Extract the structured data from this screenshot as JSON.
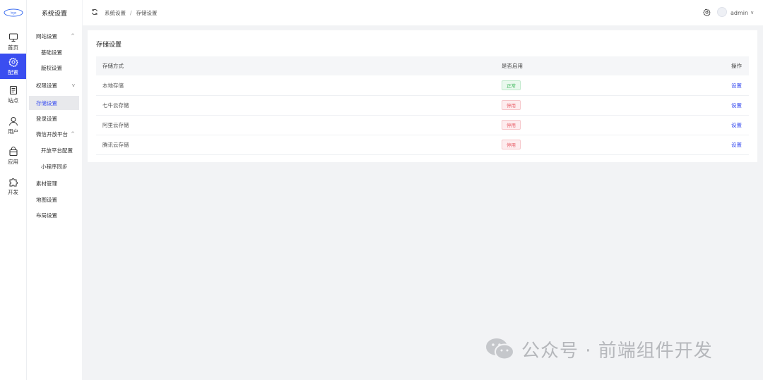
{
  "logo": {
    "text": "logo"
  },
  "rail": {
    "items": [
      {
        "label": "首页",
        "icon": "monitor-icon"
      },
      {
        "label": "配置",
        "icon": "gear-icon"
      },
      {
        "label": "站点",
        "icon": "document-icon"
      },
      {
        "label": "用户",
        "icon": "user-icon"
      },
      {
        "label": "应用",
        "icon": "bag-icon"
      },
      {
        "label": "开发",
        "icon": "puzzle-icon"
      }
    ],
    "active_index": 1
  },
  "menu": {
    "title": "系统设置",
    "items": [
      {
        "label": "网站设置",
        "kind": "group",
        "chevron": "^"
      },
      {
        "label": "基础设置",
        "kind": "sub"
      },
      {
        "label": "版权设置",
        "kind": "sub"
      },
      {
        "label": "权限设置",
        "kind": "group",
        "chevron": "v"
      },
      {
        "label": "存储设置",
        "kind": "top",
        "active": true
      },
      {
        "label": "登录设置",
        "kind": "top"
      },
      {
        "label": "微信开放平台",
        "kind": "group",
        "chevron": "^"
      },
      {
        "label": "开放平台配置",
        "kind": "sub"
      },
      {
        "label": "小程序同步",
        "kind": "sub"
      },
      {
        "label": "素材管理",
        "kind": "top"
      },
      {
        "label": "地图设置",
        "kind": "top"
      },
      {
        "label": "布局设置",
        "kind": "top"
      }
    ]
  },
  "topbar": {
    "breadcrumb": [
      "系统设置",
      "存储设置"
    ],
    "separator": "/",
    "username": "admin",
    "chevron": "∨"
  },
  "card": {
    "title": "存储设置",
    "columns": [
      "存储方式",
      "是否启用",
      "操作"
    ],
    "rows": [
      {
        "name": "本地存储",
        "status": "正常",
        "enabled": true,
        "action": "设置"
      },
      {
        "name": "七牛云存储",
        "status": "停用",
        "enabled": false,
        "action": "设置"
      },
      {
        "name": "阿里云存储",
        "status": "停用",
        "enabled": false,
        "action": "设置"
      },
      {
        "name": "腾讯云存储",
        "status": "停用",
        "enabled": false,
        "action": "设置"
      }
    ]
  },
  "watermark": {
    "text": "公众号 · 前端组件开发"
  },
  "colors": {
    "accent": "#3a4ef0",
    "success": "#3fb85c",
    "danger": "#e8616a",
    "background": "#f2f3f5"
  }
}
